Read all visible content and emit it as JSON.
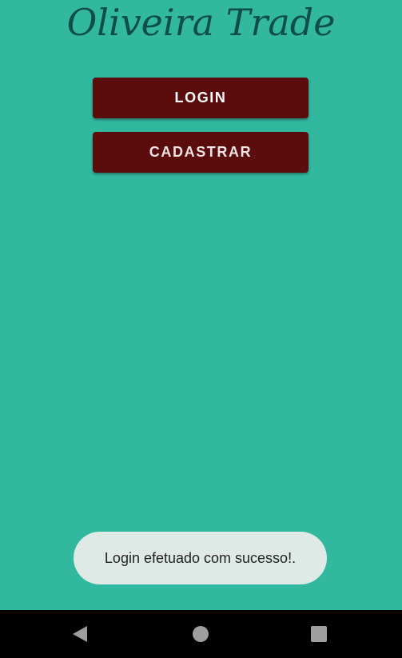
{
  "app": {
    "title": "Oliveira Trade",
    "background_color": "#33b8a0",
    "title_color": "#0d4f46",
    "button_color": "#5b0c0c"
  },
  "buttons": {
    "login_label": "LOGIN",
    "register_label": "CADASTRAR"
  },
  "toast": {
    "message": "Login efetuado com sucesso!."
  },
  "navigation_bar": {
    "icons": [
      "back-icon",
      "home-icon",
      "recents-icon"
    ],
    "icon_color": "#9e9e9e"
  }
}
